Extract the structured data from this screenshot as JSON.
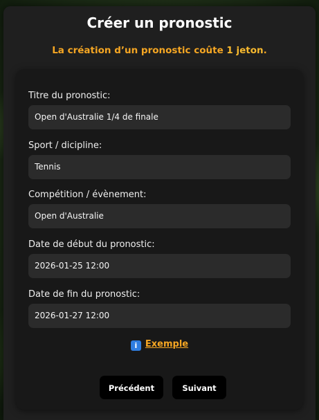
{
  "modal": {
    "title": "Créer un pronostic",
    "cost_notice_prefix": "La création d’un pronostic coûte ",
    "cost_notice_amount": "1 jeton",
    "cost_notice_suffix": "."
  },
  "form": {
    "fields": [
      {
        "label": "Titre du pronostic:",
        "value": "Open d'Australie 1/4 de finale"
      },
      {
        "label": "Sport / dicipline:",
        "value": "Tennis"
      },
      {
        "label": "Compétition / évènement:",
        "value": "Open d'Australie"
      },
      {
        "label": "Date de début du pronostic:",
        "value": "2026-01-25 12:00"
      },
      {
        "label": "Date de fin du pronostic:",
        "value": "2026-01-27 12:00"
      }
    ],
    "example_link": "Exemple",
    "example_icon": "info-icon",
    "prev_button": "Précédent",
    "next_button": "Suivant"
  },
  "colors": {
    "accent": "#f5a623",
    "info_icon": "#2f7de0"
  }
}
